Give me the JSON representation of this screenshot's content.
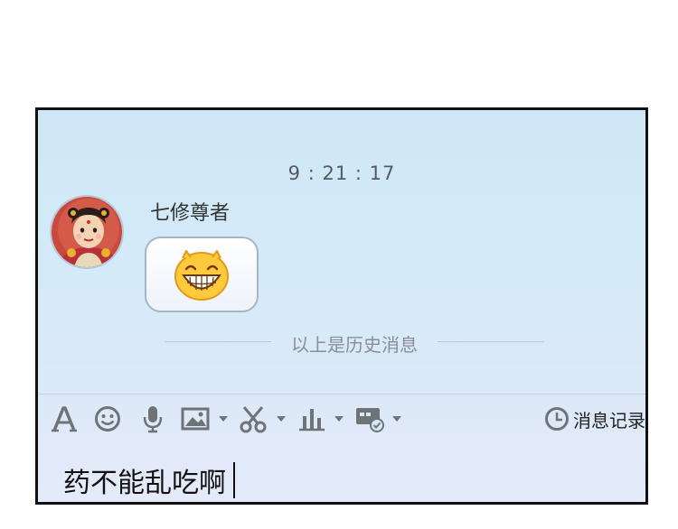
{
  "chat": {
    "timestamp": "9 : 21 : 17",
    "sender_name": "七修尊者",
    "message_emoji": "grinning-face-emoji",
    "history_divider": "以上是历史消息"
  },
  "toolbar": {
    "icons": [
      "font-icon",
      "emoji-icon",
      "microphone-icon",
      "image-icon",
      "scissors-icon",
      "chart-icon",
      "remote-assist-icon"
    ],
    "history_label": "消息记录"
  },
  "input": {
    "value": "药不能乱吃啊"
  },
  "colors": {
    "window_bg": "#d4eaf8",
    "icon_gray": "#6e7378",
    "emoji_yellow": "#ffc93c"
  }
}
